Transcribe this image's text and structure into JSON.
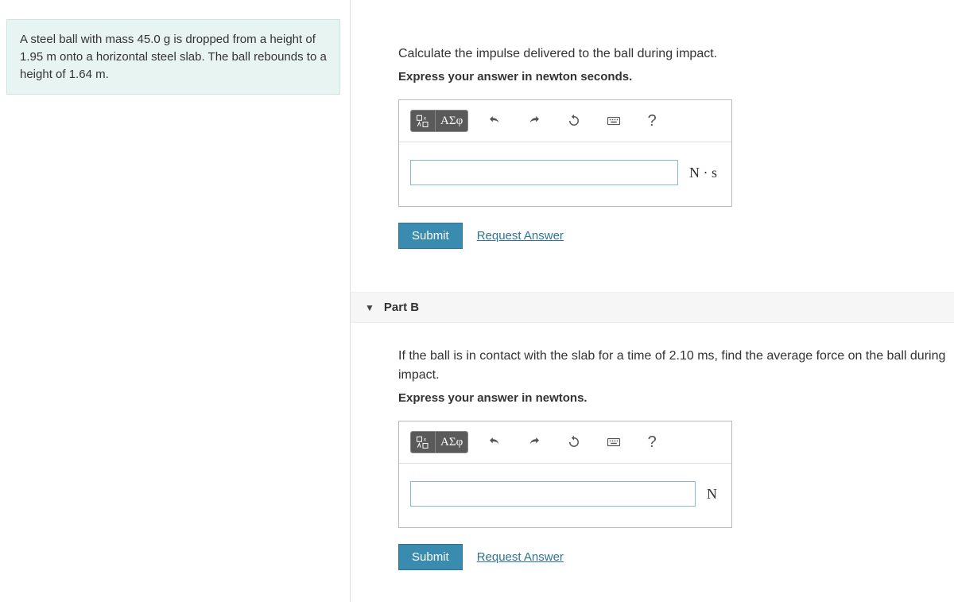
{
  "problem": {
    "text": "A steel ball with mass 45.0 g is dropped from a height of 1.95 m onto a horizontal steel slab. The ball rebounds to a height of 1.64 m."
  },
  "partA": {
    "prompt": "Calculate the impulse delivered to the ball during impact.",
    "hint": "Express your answer in newton seconds.",
    "unit": "N · s",
    "toolbar": {
      "templates": "▢√▢",
      "greek": "ΑΣφ",
      "help": "?"
    },
    "submit": "Submit",
    "request": "Request Answer",
    "answer_value": ""
  },
  "partB": {
    "title": "Part B",
    "prompt": "If the ball is in contact with the slab for a time of 2.10 ms, find the average force on the ball during impact.",
    "hint": "Express your answer in newtons.",
    "unit": "N",
    "toolbar": {
      "templates": "▢√▢",
      "greek": "ΑΣφ",
      "help": "?"
    },
    "submit": "Submit",
    "request": "Request Answer",
    "answer_value": ""
  }
}
